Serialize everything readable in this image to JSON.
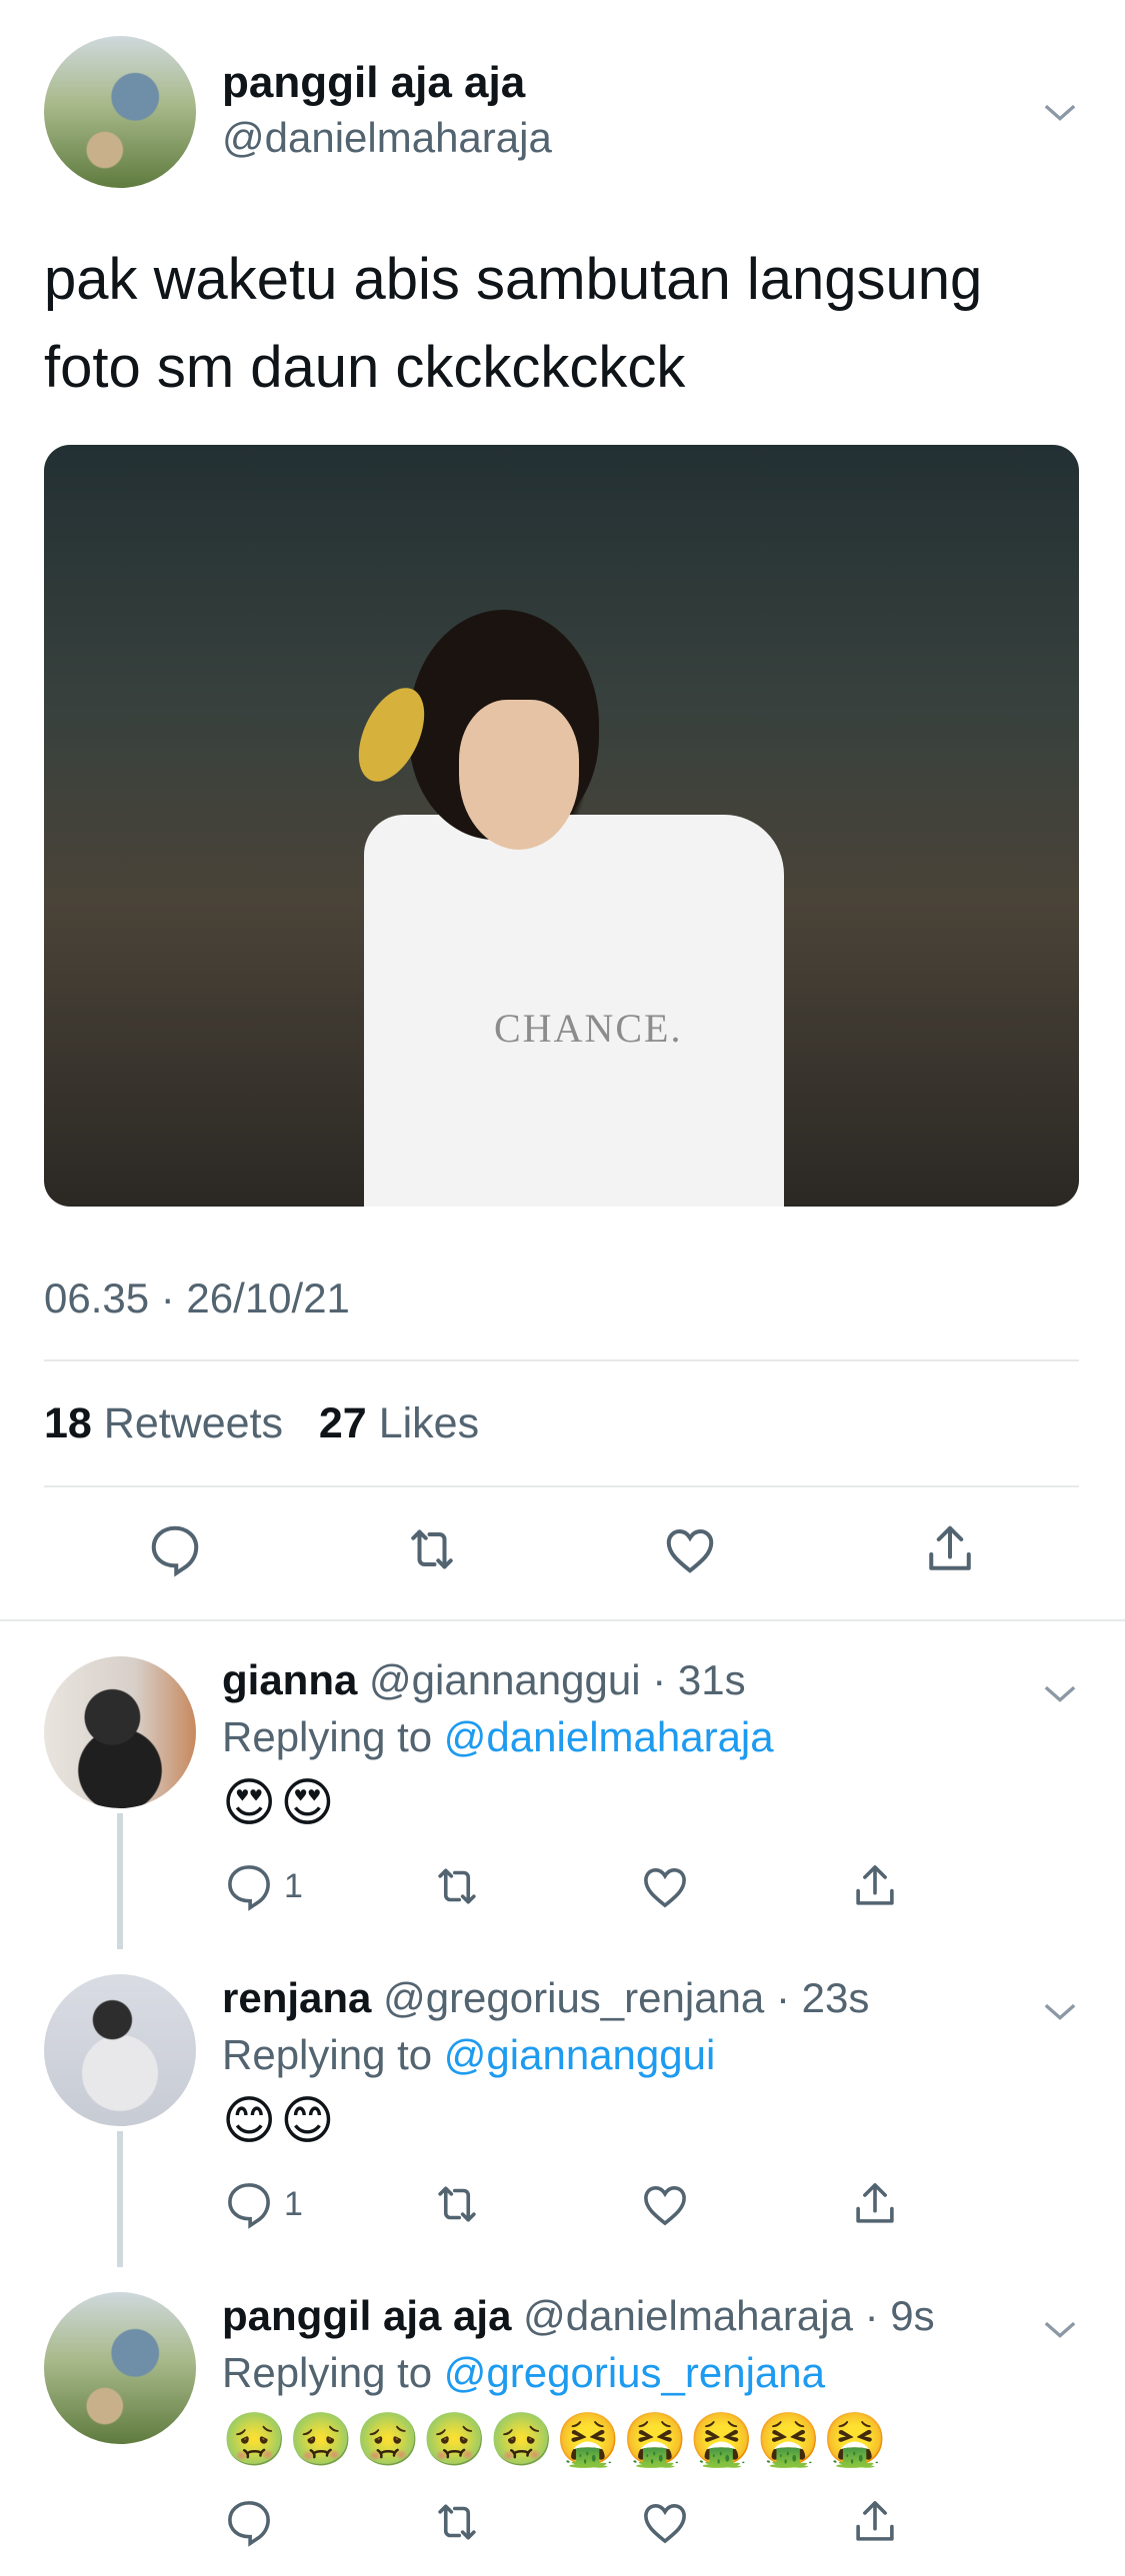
{
  "main_tweet": {
    "display_name": "panggil aja aja",
    "handle": "@danielmaharaja",
    "text_line1": "pak waketu abis sambutan langsung",
    "text_line2": "foto sm daun ckckckckck",
    "photo_shirt_logo": "CHANCE.",
    "timestamp": "06.35 · 26/10/21",
    "retweets_count": "18",
    "retweets_label": "Retweets",
    "likes_count": "27",
    "likes_label": "Likes"
  },
  "replies": [
    {
      "display_name": "gianna",
      "handle_time": "@giannanggui · 31s",
      "replying_prefix": "Replying to ",
      "replying_to": "@danielmaharaja",
      "emojis": "😍😍",
      "reply_count": "1"
    },
    {
      "display_name": "renjana",
      "handle_time": "@gregorius_renjana · 23s",
      "replying_prefix": "Replying to ",
      "replying_to": "@giannanggui",
      "emojis": "😊😊",
      "reply_count": "1"
    },
    {
      "display_name": "panggil aja aja",
      "handle_time": "@danielmaharaja · 9s",
      "replying_prefix": "Replying to ",
      "replying_to": "@gregorius_renjana",
      "emojis": "🤢🤢🤢🤢🤢🤮🤮🤮🤮🤮",
      "reply_count": ""
    }
  ],
  "icons": [
    "chevron-down-icon",
    "reply-icon",
    "retweet-icon",
    "like-icon",
    "share-icon"
  ],
  "colors": {
    "text": "#0f1419",
    "secondary": "#536471",
    "link": "#1d9bf0",
    "divider": "#e7e9ea",
    "thread_line": "#cfd9de"
  }
}
